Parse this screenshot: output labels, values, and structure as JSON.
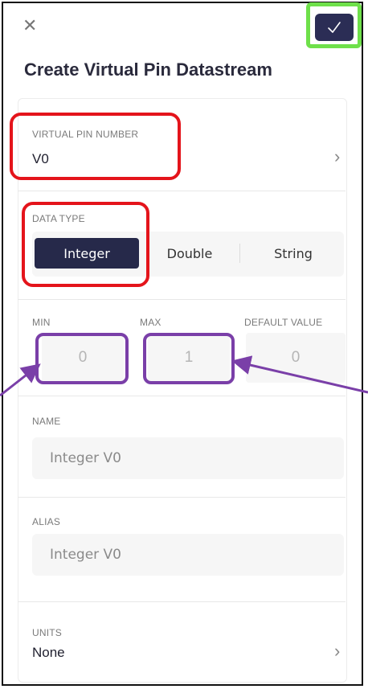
{
  "header": {
    "title": "Create Virtual Pin Datastream",
    "close_icon": "close-icon",
    "confirm_icon": "checkmark-icon"
  },
  "pin": {
    "label": "VIRTUAL PIN NUMBER",
    "value": "V0"
  },
  "data_type": {
    "label": "DATA TYPE",
    "options": [
      "Integer",
      "Double",
      "String"
    ],
    "selected": "Integer"
  },
  "range": {
    "min_label": "MIN",
    "max_label": "MAX",
    "default_label": "DEFAULT VALUE",
    "min_value": "0",
    "max_value": "1",
    "default_value": "0"
  },
  "name": {
    "label": "NAME",
    "value": "Integer V0"
  },
  "alias": {
    "label": "ALIAS",
    "value": "Integer V0"
  },
  "units": {
    "label": "UNITS",
    "value": "None"
  },
  "colors": {
    "accent": "#26294a",
    "highlight_red": "#e4141b",
    "highlight_green": "#6ee04a",
    "highlight_purple": "#7a3fa8"
  }
}
